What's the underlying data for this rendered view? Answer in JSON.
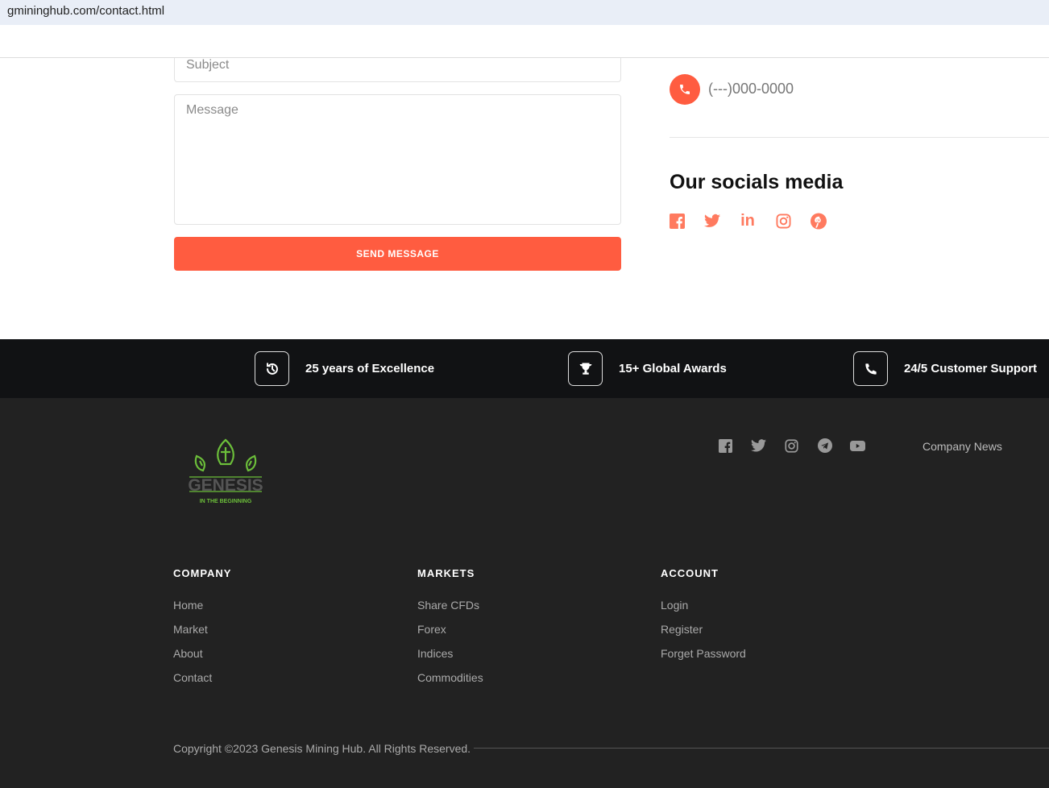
{
  "browser": {
    "url": "gmininghub.com/contact.html"
  },
  "form": {
    "subject_placeholder": "Subject",
    "message_placeholder": "Message",
    "send_label": "SEND MESSAGE"
  },
  "contact": {
    "phone": "(---)000-0000",
    "socials_title": "Our socials media",
    "socials": [
      "facebook-icon",
      "twitter-icon",
      "linkedin-icon",
      "instagram-icon",
      "pinterest-icon"
    ],
    "accent": "#ff5c40"
  },
  "features": [
    {
      "icon": "history-icon",
      "label": "25 years of Excellence"
    },
    {
      "icon": "trophy-icon",
      "label": "15+ Global Awards"
    },
    {
      "icon": "phone-icon",
      "label": "24/5 Customer Support"
    }
  ],
  "footer": {
    "logo": {
      "name": "GENESIS",
      "tagline": "IN THE BEGINNING"
    },
    "company_news": "Company News",
    "columns": [
      {
        "title": "COMPANY",
        "links": [
          "Home",
          "Market",
          "About",
          "Contact"
        ]
      },
      {
        "title": "MARKETS",
        "links": [
          "Share CFDs",
          "Forex",
          "Indices",
          "Commodities"
        ]
      },
      {
        "title": "ACCOUNT",
        "links": [
          "Login",
          "Register",
          "Forget Password"
        ]
      }
    ],
    "copyright": "Copyright ©2023 Genesis Mining Hub. All Rights Reserved."
  }
}
